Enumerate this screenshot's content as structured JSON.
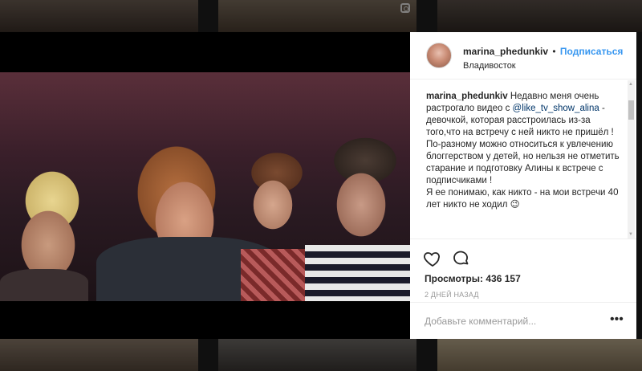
{
  "post": {
    "username": "marina_phedunkiv",
    "separator": "•",
    "follow_label": "Подписаться",
    "location": "Владивосток",
    "caption": {
      "username": "marina_phedunkiv",
      "text_1": " Недавно меня очень растрогало видео с ",
      "mention": "@like_tv_show_alina",
      "text_2": " - девочкой, которая расстроилась из-за того,что на встречу с ней никто не пришёл !",
      "paragraph_2": "По-разному можно относиться к увлечению блоггерством у детей, но нельзя не отметить старание и подготовку Алины к встрече с подписчиками !",
      "paragraph_3": "Я ее понимаю, как никто - на мои встречи 40 лет никто не ходил 😉"
    },
    "views_label": "Просмотры:",
    "views_count": "436 157",
    "time_ago": "2 ДНЕЙ НАЗАД",
    "comment_placeholder": "Добавьте комментарий...",
    "more_label": "•••"
  },
  "icons": {
    "like": "heart-icon",
    "comment": "comment-icon",
    "more": "more-options-icon",
    "thumb_type": "video-icon"
  },
  "colors": {
    "link": "#3897f0",
    "mention": "#003569",
    "text": "#262626",
    "muted": "#999999"
  }
}
